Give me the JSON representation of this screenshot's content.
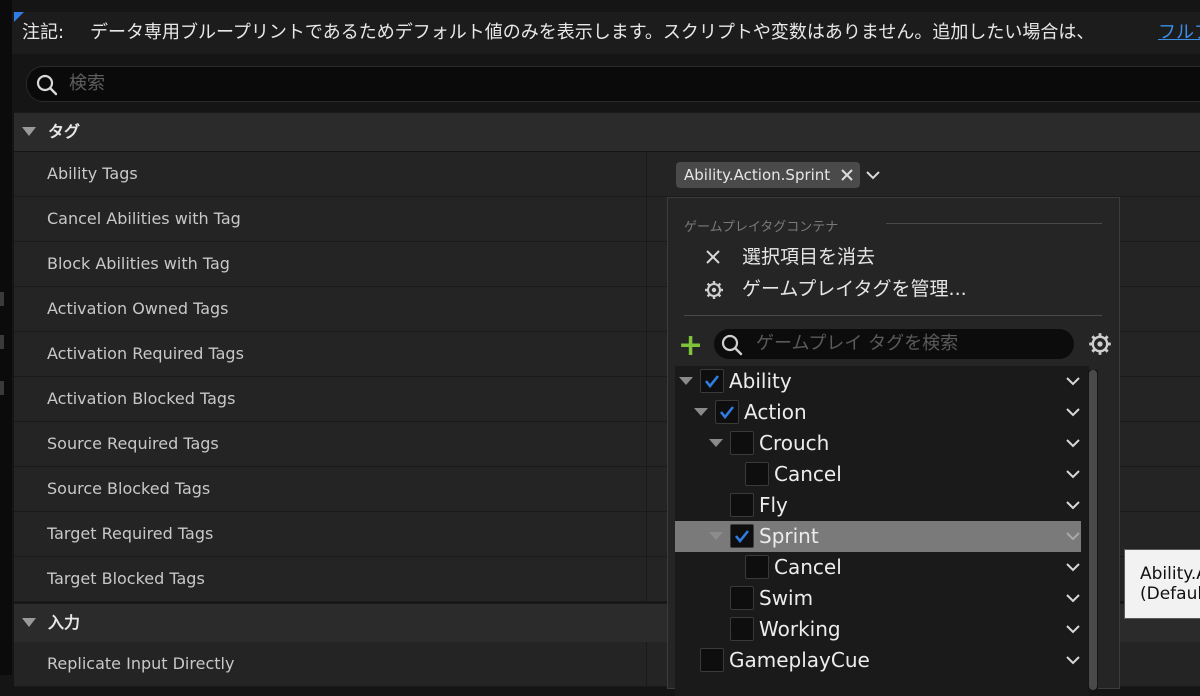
{
  "notice": {
    "label": "注記:",
    "text": "データ専用ブループリントであるためデフォルト値のみを表示します。スクリプトや変数はありません。追加したい場合は、",
    "link": "フルブ"
  },
  "search": {
    "placeholder": "検索"
  },
  "sections": {
    "tags": "タグ",
    "input": "入力"
  },
  "properties": [
    "Ability Tags",
    "Cancel Abilities with Tag",
    "Block Abilities with Tag",
    "Activation Owned Tags",
    "Activation Required Tags",
    "Activation Blocked Tags",
    "Source Required Tags",
    "Source Blocked Tags",
    "Target Required Tags",
    "Target Blocked Tags"
  ],
  "input_properties": [
    "Replicate Input Directly"
  ],
  "ability_tags_value": "Ability.Action.Sprint",
  "popup": {
    "container_title": "ゲームプレイタグコンテナ",
    "clear_selection": "選択項目を消去",
    "manage_tags": "ゲームプレイタグを管理...",
    "tag_search_placeholder": "ゲームプレイ タグを検索"
  },
  "tree": [
    {
      "label": "Ability",
      "checked": true,
      "expanded": true,
      "depth": 0
    },
    {
      "label": "Action",
      "checked": true,
      "expanded": true,
      "depth": 1
    },
    {
      "label": "Crouch",
      "checked": false,
      "expanded": true,
      "depth": 2
    },
    {
      "label": "Cancel",
      "checked": false,
      "expanded": false,
      "depth": 3
    },
    {
      "label": "Fly",
      "checked": false,
      "expanded": false,
      "depth": 2
    },
    {
      "label": "Sprint",
      "checked": true,
      "expanded": true,
      "depth": 2,
      "selected": true
    },
    {
      "label": "Cancel",
      "checked": false,
      "expanded": false,
      "depth": 3
    },
    {
      "label": "Swim",
      "checked": false,
      "expanded": false,
      "depth": 2
    },
    {
      "label": "Working",
      "checked": false,
      "expanded": false,
      "depth": 2
    },
    {
      "label": "GameplayCue",
      "checked": false,
      "expanded": false,
      "depth": 0
    }
  ],
  "tooltip": {
    "line1": "Ability.A",
    "line2": "(Defaul"
  },
  "colors": {
    "accent": "#2f7de1",
    "add": "#7ec33a",
    "selected_row": "#7a7a7a"
  },
  "icons": [
    "search-icon",
    "close-icon",
    "chevron-down-icon",
    "gear-icon",
    "plus-icon",
    "check-icon",
    "expand-arrow-icon"
  ]
}
